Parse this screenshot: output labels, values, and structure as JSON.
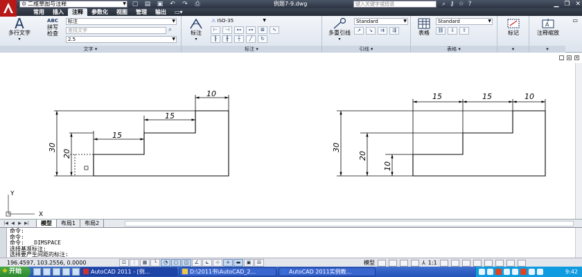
{
  "titlebar": {
    "workspace": "二维草图与注释",
    "document_title": "例题7-9.dwg",
    "search_placeholder": "键入关键字或短语",
    "quick_access": [
      "new-icon",
      "open-icon",
      "save-icon",
      "undo-icon",
      "redo-icon",
      "print-icon"
    ]
  },
  "ribbon_tabs": [
    "常用",
    "插入",
    "注释",
    "参数化",
    "视图",
    "管理",
    "输出"
  ],
  "ribbon_tab_active": "注释",
  "ribbon": {
    "text_panel": {
      "title": "文字",
      "multiline_text": "多行文字",
      "multiline_icon": "A",
      "spell_check_line1": "拼写",
      "spell_check_line2": "检查",
      "spell_icon": "ABC",
      "style_value": "标注",
      "find_placeholder": "查找文字",
      "height_value": "2.5"
    },
    "dim_panel": {
      "title": "标注",
      "dimension": "标注",
      "style_value": "ISO-35"
    },
    "leader_panel": {
      "title": "引线",
      "multileader": "多重引线",
      "style_value": "Standard"
    },
    "table_panel": {
      "title": "表格",
      "table": "表格",
      "style_value": "Standard"
    },
    "markup_panel": {
      "label": "标记"
    },
    "scale_panel": {
      "label": "注释缩放"
    }
  },
  "drawing": {
    "left_view": {
      "dims": [
        "10",
        "15",
        "15",
        "30",
        "20"
      ]
    },
    "right_view": {
      "dims": [
        "15",
        "15",
        "10",
        "30",
        "20",
        "10"
      ]
    },
    "ucs": {
      "x": "X",
      "y": "Y"
    }
  },
  "layout_tabs": [
    "模型",
    "布局1",
    "布局2"
  ],
  "layout_tab_active": "模型",
  "command_lines": [
    "命令:",
    "命令:",
    "命令:  _DIMSPACE",
    "选择基准标注:",
    "选择要产生间距的标注:"
  ],
  "statusbar": {
    "coordinates": "196.4597, 103.2556, 0.0000",
    "model_label": "模型",
    "annotation_scale": "1:1"
  },
  "taskbar": {
    "start": "开始",
    "tasks": [
      "AutoCAD 2011 - [例...",
      "D:\\2011书\\AutoCAD_2...",
      "AutoCAD 2011实例教..."
    ],
    "clock": "9:42"
  },
  "colors": {
    "titlebar": "#2c3442",
    "ribbon": "#e9eef5",
    "taskbar": "#2352b8",
    "start": "#2f8a2f"
  }
}
